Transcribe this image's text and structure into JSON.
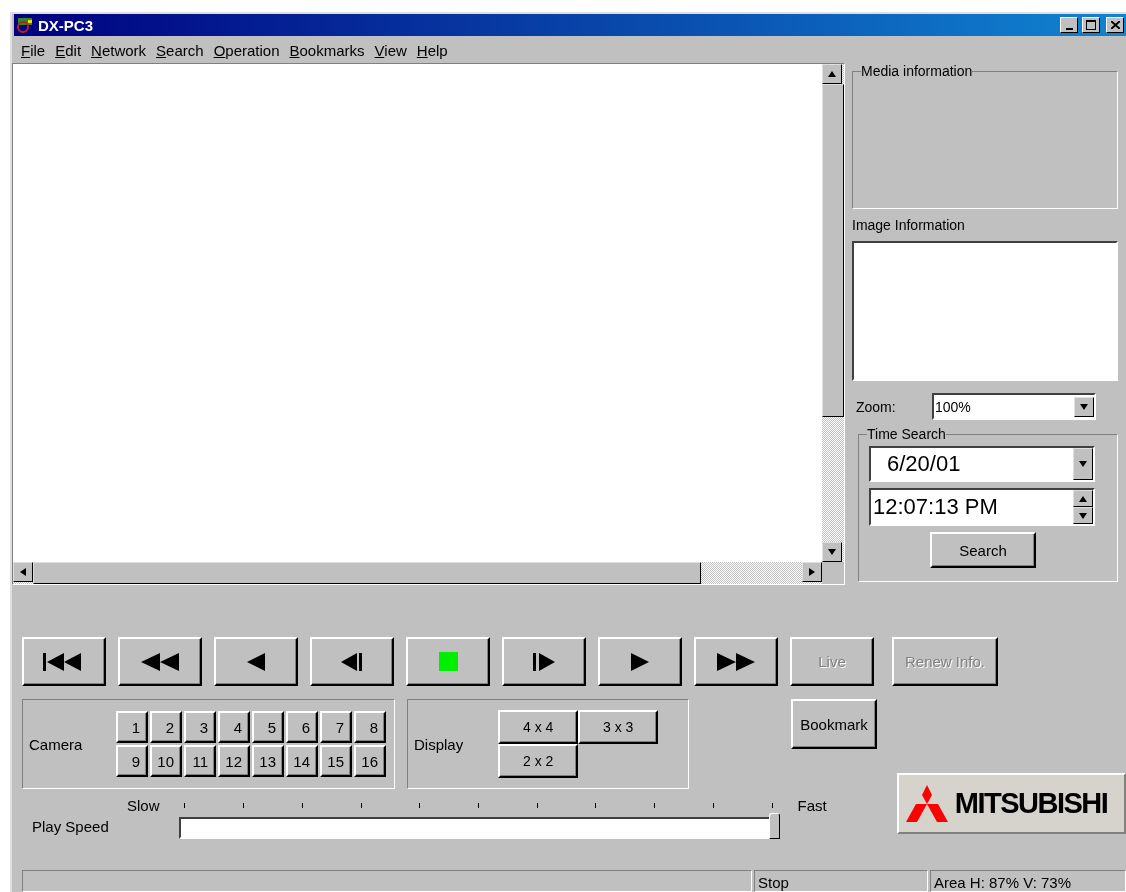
{
  "window": {
    "title": "DX-PC3"
  },
  "menu": [
    "File",
    "Edit",
    "Network",
    "Search",
    "Operation",
    "Bookmarks",
    "View",
    "Help"
  ],
  "media_information": {
    "title": "Media information"
  },
  "image_information": {
    "label": "Image Information"
  },
  "zoom": {
    "label": "Zoom:",
    "value": "100%"
  },
  "time_search": {
    "title": "Time Search",
    "date": "6/20/01",
    "time": "12:07:13 PM",
    "button": "Search"
  },
  "transport": [
    {
      "kind": "first"
    },
    {
      "kind": "rewind"
    },
    {
      "kind": "back"
    },
    {
      "kind": "step-back"
    },
    {
      "kind": "stop"
    },
    {
      "kind": "step-forward"
    },
    {
      "kind": "play"
    },
    {
      "kind": "fast-forward"
    }
  ],
  "actions": [
    {
      "label": "Live",
      "disabled": true
    },
    {
      "label": "Renew Info.",
      "disabled": true
    }
  ],
  "bookmark": {
    "label": "Bookmark",
    "disabled": false
  },
  "camera": {
    "label": "Camera",
    "buttons": [
      "1",
      "2",
      "3",
      "4",
      "5",
      "6",
      "7",
      "8",
      "9",
      "10",
      "11",
      "12",
      "13",
      "14",
      "15",
      "16"
    ]
  },
  "display": {
    "label": "Display",
    "buttons": [
      "4 x 4",
      "3 x 3",
      "2 x 2"
    ]
  },
  "play_speed": {
    "label": "Play Speed",
    "slow": "Slow",
    "fast": "Fast",
    "level": 1
  },
  "logo": {
    "text": "MITSUBISHI"
  },
  "status_bar": [
    "Stop",
    "Area H: 87% V: 73%"
  ]
}
